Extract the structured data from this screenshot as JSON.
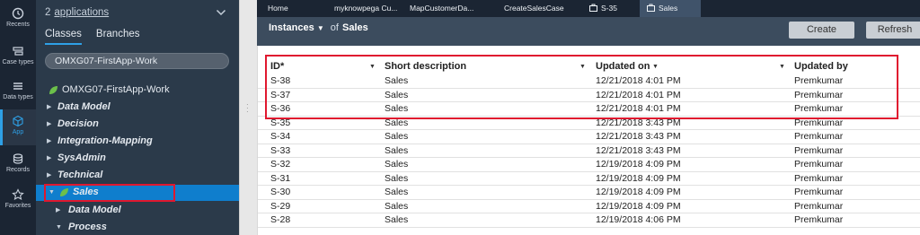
{
  "rail": {
    "items": [
      {
        "label": "Recents"
      },
      {
        "label": "Case types"
      },
      {
        "label": "Data types"
      },
      {
        "label": "App"
      },
      {
        "label": "Records"
      },
      {
        "label": "Favorites"
      }
    ]
  },
  "explorer": {
    "app_count": "2",
    "apps_link": "applications",
    "tabs": [
      "Classes",
      "Branches"
    ],
    "class_value": "OMXG07-FirstApp-Work",
    "root": "OMXG07-FirstApp-Work",
    "nodes": [
      "Data Model",
      "Decision",
      "Integration-Mapping",
      "SysAdmin",
      "Technical"
    ],
    "selected": "Sales",
    "children": [
      "Data Model",
      "Process"
    ]
  },
  "tabbar": {
    "tabs": [
      "Home",
      "myknowpega Cu...",
      "MapCustomerDa...",
      "CreateSalesCase",
      "S-35",
      "Sales"
    ]
  },
  "header": {
    "instances_label": "Instances",
    "of_label": "of",
    "class_label": "Sales",
    "create_label": "Create",
    "refresh_label": "Refresh"
  },
  "grid": {
    "columns": [
      "ID*",
      "Short description",
      "Updated on",
      "Updated by"
    ],
    "rows": [
      [
        "S-38",
        "Sales",
        "12/21/2018 4:01 PM",
        "Premkumar"
      ],
      [
        "S-37",
        "Sales",
        "12/21/2018 4:01 PM",
        "Premkumar"
      ],
      [
        "S-36",
        "Sales",
        "12/21/2018 4:01 PM",
        "Premkumar"
      ],
      [
        "S-35",
        "Sales",
        "12/21/2018 3:43 PM",
        "Premkumar"
      ],
      [
        "S-34",
        "Sales",
        "12/21/2018 3:43 PM",
        "Premkumar"
      ],
      [
        "S-33",
        "Sales",
        "12/21/2018 3:43 PM",
        "Premkumar"
      ],
      [
        "S-32",
        "Sales",
        "12/19/2018 4:09 PM",
        "Premkumar"
      ],
      [
        "S-31",
        "Sales",
        "12/19/2018 4:09 PM",
        "Premkumar"
      ],
      [
        "S-30",
        "Sales",
        "12/19/2018 4:09 PM",
        "Premkumar"
      ],
      [
        "S-29",
        "Sales",
        "12/19/2018 4:09 PM",
        "Premkumar"
      ],
      [
        "S-28",
        "Sales",
        "12/19/2018 4:06 PM",
        "Premkumar"
      ]
    ]
  }
}
